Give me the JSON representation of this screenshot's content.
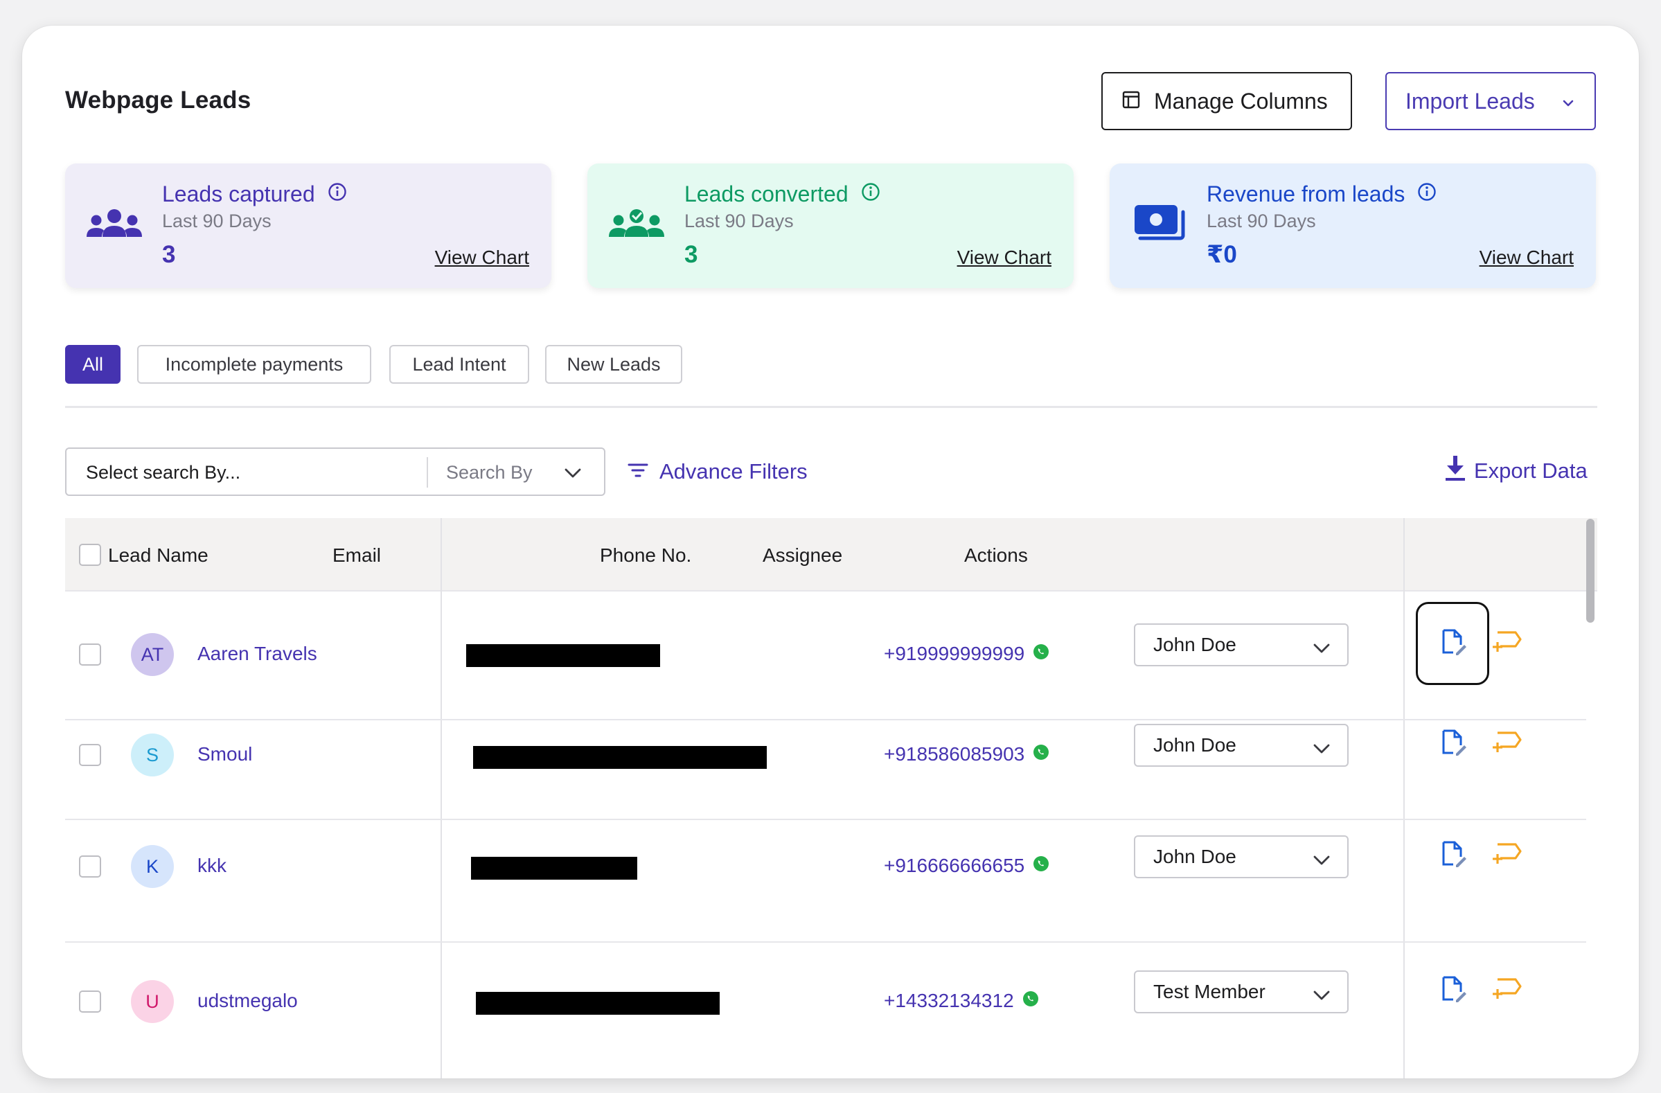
{
  "header": {
    "title": "Webpage Leads",
    "manage_columns": "Manage Columns",
    "import_leads": "Import Leads"
  },
  "cards": [
    {
      "title": "Leads captured",
      "period": "Last 90 Days",
      "value": "3",
      "link": "View Chart",
      "icon": "users-group-icon",
      "color": "#4533b0"
    },
    {
      "title": "Leads converted",
      "period": "Last 90 Days",
      "value": "3",
      "link": "View Chart",
      "icon": "users-check-icon",
      "color": "#0d9a63"
    },
    {
      "title": "Revenue from leads",
      "period": "Last 90 Days",
      "value": "₹0",
      "link": "View Chart",
      "icon": "money-icon",
      "color": "#1a47c8"
    }
  ],
  "filters": {
    "tabs": [
      "All",
      "Incomplete payments",
      "Lead Intent",
      "New Leads"
    ],
    "active": "All"
  },
  "search": {
    "placeholder": "Select search By...",
    "search_by": "Search By",
    "advance_filters": "Advance Filters",
    "export": "Export Data"
  },
  "table": {
    "columns": [
      "Lead Name",
      "Email",
      "Phone No.",
      "Assignee",
      "Actions"
    ],
    "rows": [
      {
        "initials": "AT",
        "name": "Aaren Travels",
        "phone": "+919999999999",
        "assignee": "John Doe",
        "avatar_bg": "#cfc6ee",
        "avatar_fg": "#4533b0"
      },
      {
        "initials": "S",
        "name": "Smoul",
        "phone": "+918586085903",
        "assignee": "John Doe",
        "avatar_bg": "#cdeffa",
        "avatar_fg": "#1a9ad0"
      },
      {
        "initials": "K",
        "name": "kkk",
        "phone": "+916666666655",
        "assignee": "John Doe",
        "avatar_bg": "#d6e5fc",
        "avatar_fg": "#1a47c8"
      },
      {
        "initials": "U",
        "name": "udstmegalo",
        "phone": "+14332134312",
        "assignee": "Test Member",
        "avatar_bg": "#fbd3e6",
        "avatar_fg": "#d0176a"
      }
    ]
  },
  "colors": {
    "accent": "#4533b0",
    "success": "#0d9a63",
    "info": "#1a47c8",
    "action_edit": "#1a5fd8",
    "action_followup": "#f5a623",
    "whatsapp": "#25b04a"
  }
}
